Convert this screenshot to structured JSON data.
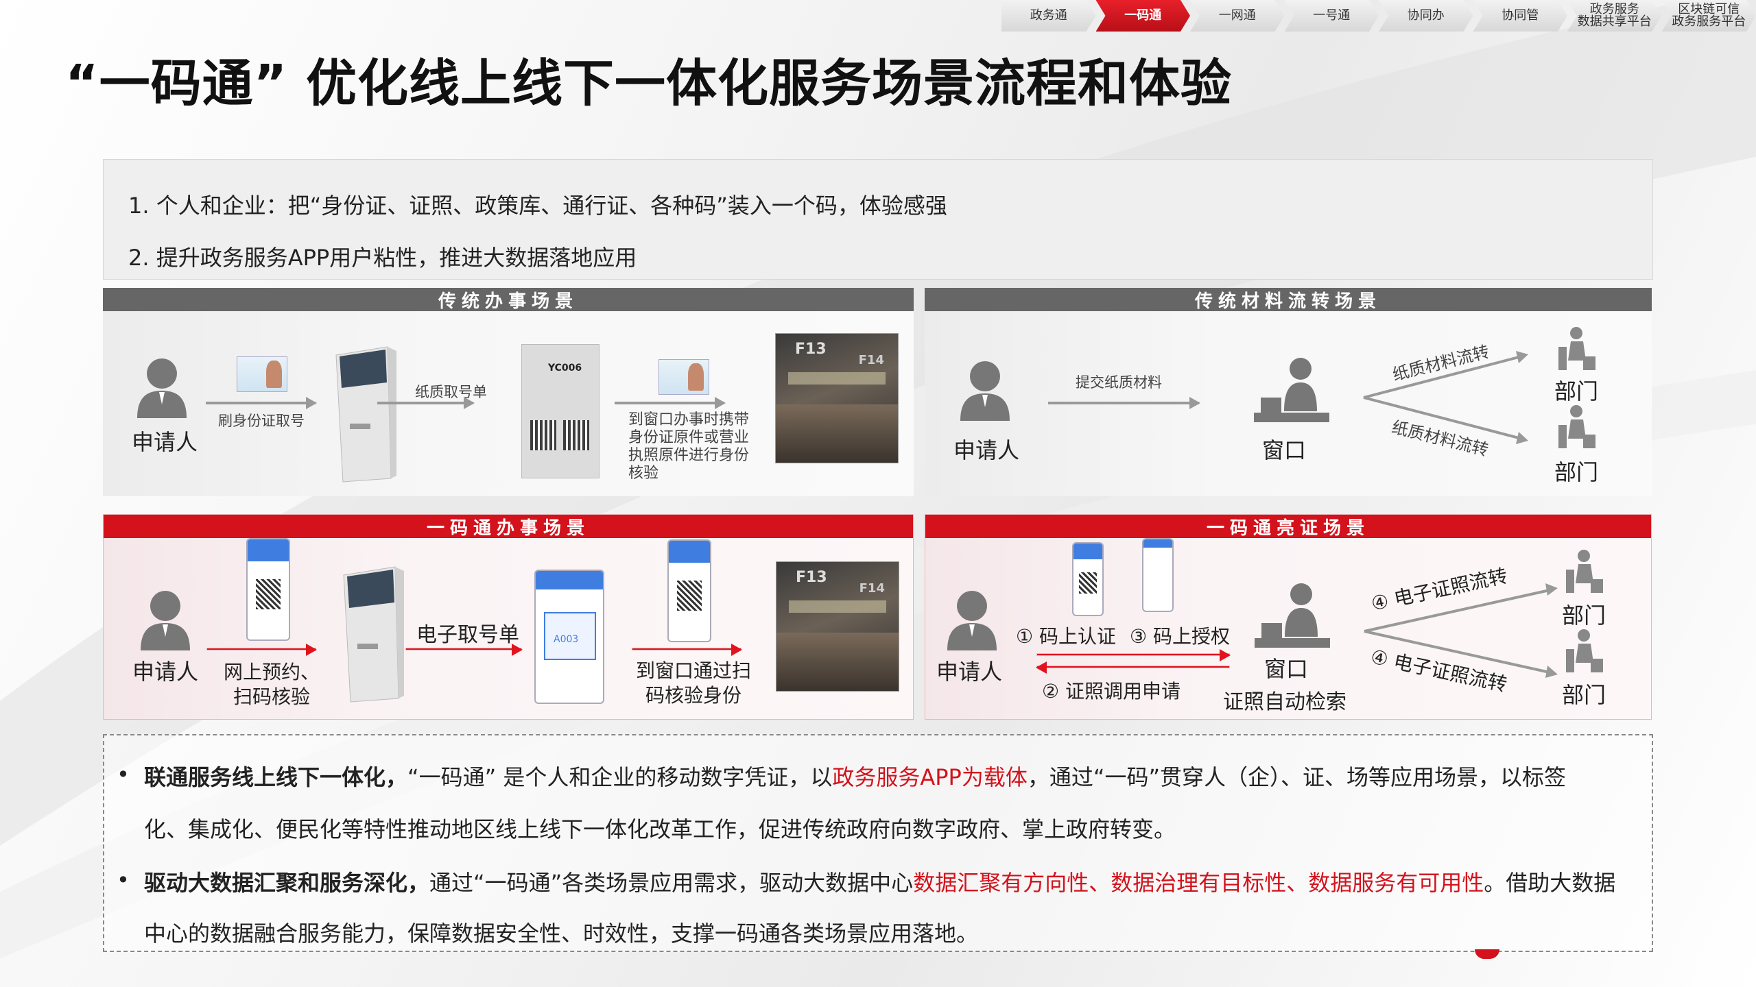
{
  "nav": {
    "items": [
      "政务通",
      "一码通",
      "一网通",
      "一号通",
      "协同办",
      "协同管",
      "政务服务\n数据共享平台",
      "区块链可信\n政务服务平台"
    ],
    "active_index": 1
  },
  "title": "“一码通” 优化线上线下一体化服务场景流程和体验",
  "summary": {
    "line1": "1. 个人和企业：把“身份证、证照、政策库、通行证、各种码”装入一个码，体验感强",
    "line2": "2. 提升政务服务APP用户粘性，推进大数据落地应用"
  },
  "panels": {
    "traditional": {
      "header": "传统办事场景",
      "applicant": "申请人",
      "step1": "刷身份证取号",
      "step2": "纸质取号单",
      "ticket_code": "YC006",
      "step3": "到窗口办事时携带身份证原件或营业执照原件进行身份核验"
    },
    "material": {
      "header": "传统材料流转场景",
      "applicant": "申请人",
      "submit": "提交纸质材料",
      "window": "窗口",
      "flow_up": "纸质材料流转",
      "flow_down": "纸质材料流转",
      "dept1": "部门",
      "dept2": "部门"
    },
    "ymt_service": {
      "header": "一码通办事场景",
      "applicant": "申请人",
      "step1": "网上预约、\n扫码核验",
      "step2": "电子取号单",
      "ticket_code": "A003",
      "step3": "到窗口通过扫\n码核验身份"
    },
    "ymt_cert": {
      "header": "一码通亮证场景",
      "applicant": "申请人",
      "auth1": "① 码上认证",
      "auth3": "③ 码上授权",
      "auth2": "② 证照调用申请",
      "window": "窗口",
      "search": "证照自动检索",
      "flow_up": "④ 电子证照流转",
      "flow_down": "④ 电子证照流转",
      "dept1": "部门",
      "dept2": "部门"
    }
  },
  "bottom": {
    "p1_bold": "联通服务线上线下一体化，",
    "p1_a": "“一码通” 是个人和企业的移动数字凭证，以",
    "p1_red": "政务服务APP为载体",
    "p1_b": "，通过“一码”贯穿人（企）、证、场等应用场景，以标签",
    "p1_c": "化、集成化、便民化等特性推动地区线上线下一体化改革工作，促进传统政府向数字政府、掌上政府转变。",
    "p2_bold": "驱动大数据汇聚和服务深化，",
    "p2_a": "通过“一码通”各类场景应用需求，驱动大数据中心",
    "p2_red": "数据汇聚有方向性、数据治理有目标性、数据服务有可用性",
    "p2_b": "。借助大数据",
    "p2_c": "中心的数据融合服务能力，保障数据安全性、时效性，支撑一码通各类场景应用落地。"
  }
}
